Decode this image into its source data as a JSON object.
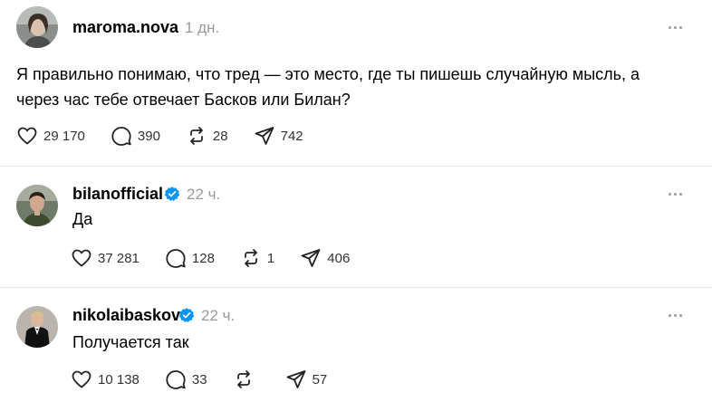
{
  "posts": [
    {
      "username": "maroma.nova",
      "verified": false,
      "time": "1 дн.",
      "text": "Я правильно понимаю, что тред — это место, где ты пишешь случайную мысль, а через час тебе отвечает Басков или Билан?",
      "likes": "29 170",
      "replies": "390",
      "reposts": "28",
      "shares": "742"
    },
    {
      "username": "bilanofficial",
      "verified": true,
      "time": "22 ч.",
      "text": "Да",
      "likes": "37 281",
      "replies": "128",
      "reposts": "1",
      "shares": "406"
    },
    {
      "username": "nikolaibaskov",
      "verified": true,
      "time": "22 ч.",
      "text": "Получается так",
      "likes": "10 138",
      "replies": "33",
      "reposts": "",
      "shares": "57"
    }
  ],
  "colors": {
    "verified_blue": "#0095f6",
    "muted": "#999999"
  }
}
